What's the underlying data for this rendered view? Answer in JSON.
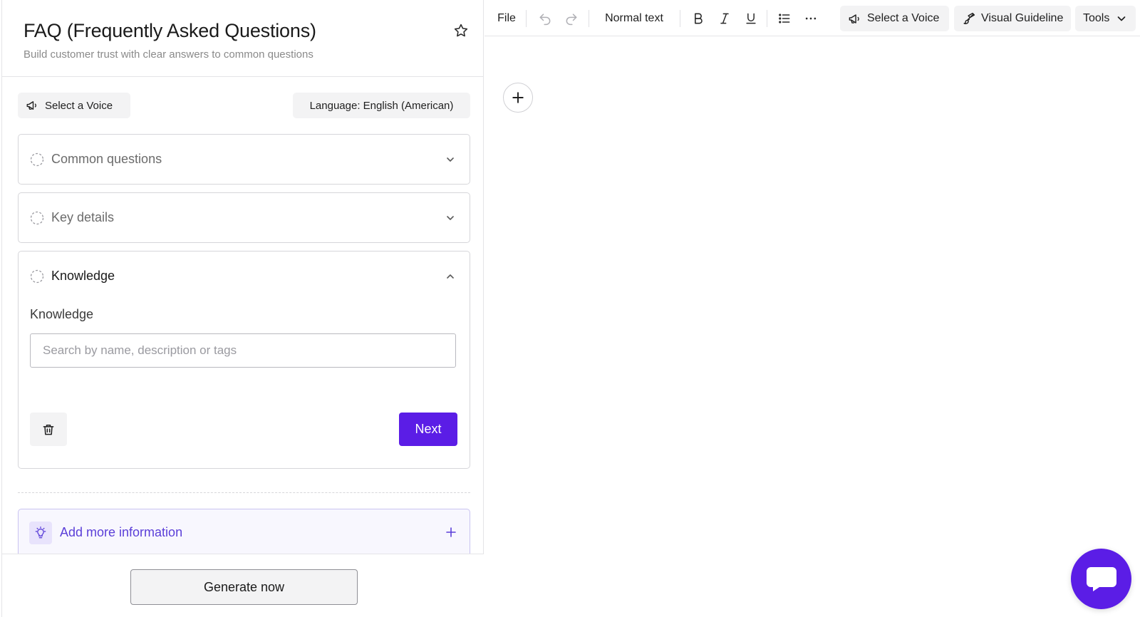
{
  "header": {
    "title": "FAQ (Frequently Asked Questions)",
    "subtitle": "Build customer trust with clear answers to common questions"
  },
  "controls": {
    "voice_label": "Select a Voice",
    "language_label": "Language: English (American)"
  },
  "sections": [
    {
      "label": "Common questions",
      "expanded": false
    },
    {
      "label": "Key details",
      "expanded": false
    },
    {
      "label": "Knowledge",
      "expanded": true
    }
  ],
  "knowledge": {
    "field_label": "Knowledge",
    "search_value": "",
    "search_placeholder": "Search by name, description or tags",
    "next_label": "Next"
  },
  "add_more_label": "Add more information",
  "generate_label": "Generate now",
  "toolbar": {
    "file_label": "File",
    "text_style_label": "Normal text",
    "voice_label": "Select a Voice",
    "guideline_label": "Visual Guideline",
    "tools_label": "Tools"
  },
  "icons": {
    "star": "star-icon",
    "voice": "megaphone-icon",
    "section_status": "dashed-circle-icon",
    "chevron": "chevron-icon",
    "trash": "trash-icon",
    "bulb": "lightbulb-icon",
    "plus": "plus-icon",
    "undo": "undo-icon",
    "redo": "redo-icon",
    "bold": "bold-icon",
    "italic": "italic-icon",
    "underline": "underline-icon",
    "list": "bullet-list-icon",
    "more": "more-horizontal-icon",
    "brush": "paintbrush-icon",
    "chat": "chat-icon"
  },
  "colors": {
    "primary": "#5b1de6",
    "accent_text": "#5b3fd8",
    "accent_bg": "#f8f7fe",
    "chip_bg": "#f3f3f4",
    "border": "#d6d6da"
  }
}
